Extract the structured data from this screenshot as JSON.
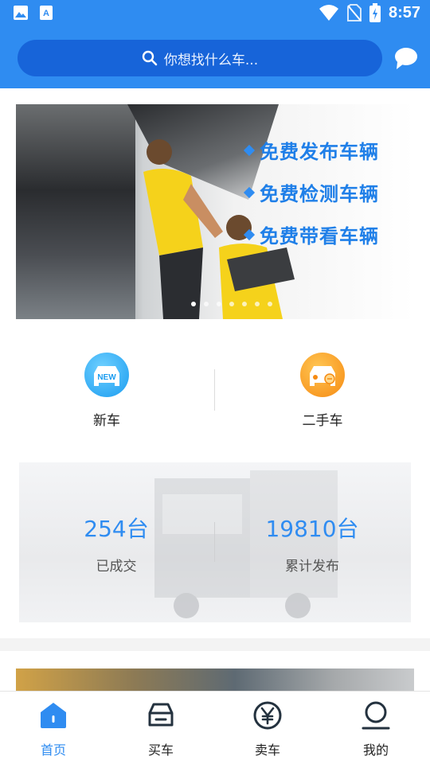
{
  "status_bar": {
    "time": "8:57",
    "icons": [
      "image-icon",
      "text-icon",
      "wifi-icon",
      "no-sim-icon",
      "battery-icon"
    ]
  },
  "search": {
    "placeholder": "你想找什么车..."
  },
  "banner": {
    "slogans": [
      "免费发布车辆",
      "免费检测车辆",
      "免费带看车辆"
    ],
    "dot_count": 7,
    "active_dot": 0
  },
  "categories": [
    {
      "label": "新车",
      "icon": "new-car-icon",
      "badge": "NEW"
    },
    {
      "label": "二手车",
      "icon": "used-car-icon"
    }
  ],
  "stats": [
    {
      "value": "254台",
      "caption": "已成交"
    },
    {
      "value": "19810台",
      "caption": "累计发布"
    }
  ],
  "bottom_nav": [
    {
      "label": "首页",
      "icon": "home-icon",
      "active": true
    },
    {
      "label": "买车",
      "icon": "car-icon",
      "active": false
    },
    {
      "label": "卖车",
      "icon": "yen-icon",
      "active": false
    },
    {
      "label": "我的",
      "icon": "user-icon",
      "active": false
    }
  ],
  "colors": {
    "primary": "#2f8cf1",
    "search_bg": "#1764d9",
    "new_car": "#1a9cf0",
    "used_car": "#f68a12"
  }
}
